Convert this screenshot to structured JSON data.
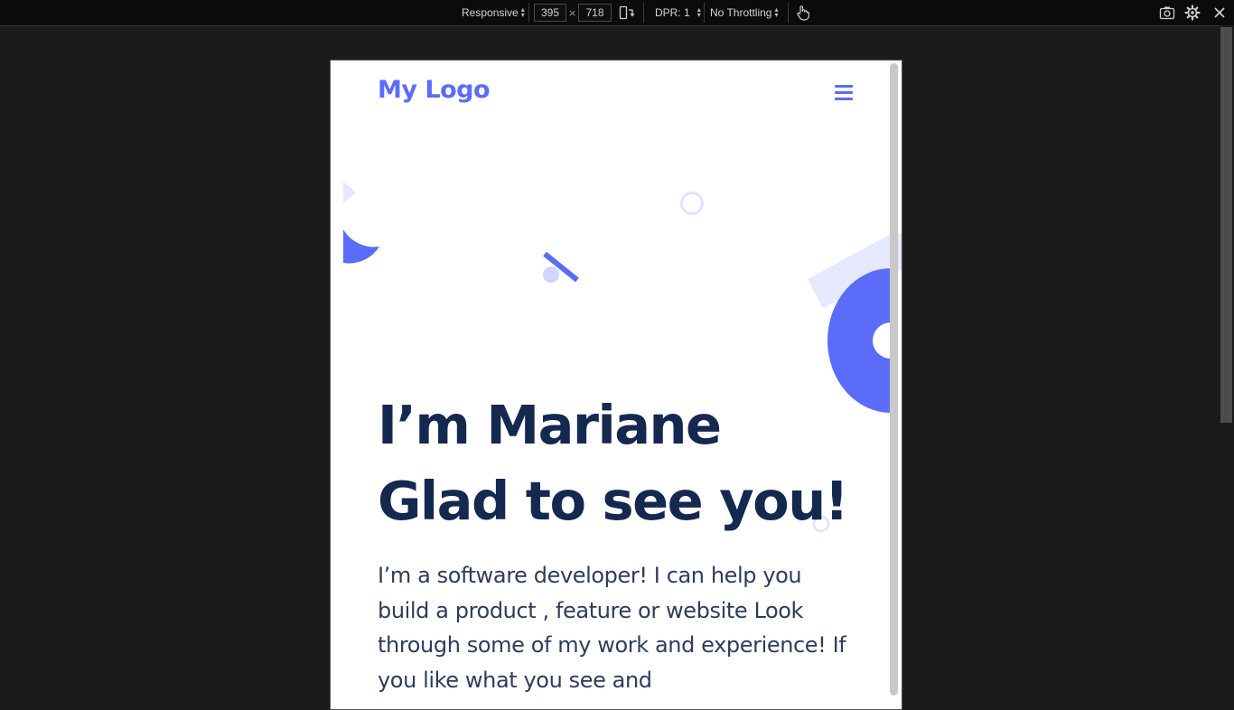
{
  "toolbar": {
    "device_mode": "Responsive",
    "width_value": "395",
    "times": "×",
    "height_value": "718",
    "dpr_label": "DPR: 1",
    "throttling_label": "No Throttling"
  },
  "page": {
    "logo": "My Logo",
    "headline_line1": "I’m Mariane",
    "headline_line2": "Glad to see you!",
    "intro": "I’m a software developer! I can help you build a product , feature or website Look through some of my work and experience! If you like what you see and"
  },
  "colors": {
    "brand": "#5b6cf9",
    "brand_light": "#e6e8fd",
    "heading": "#142850",
    "body_text": "#2e3c5c"
  },
  "icons": [
    "rotate-device-icon",
    "touch-simulation-icon",
    "screenshot-icon",
    "settings-gear-icon",
    "close-icon",
    "hamburger-menu-icon"
  ]
}
